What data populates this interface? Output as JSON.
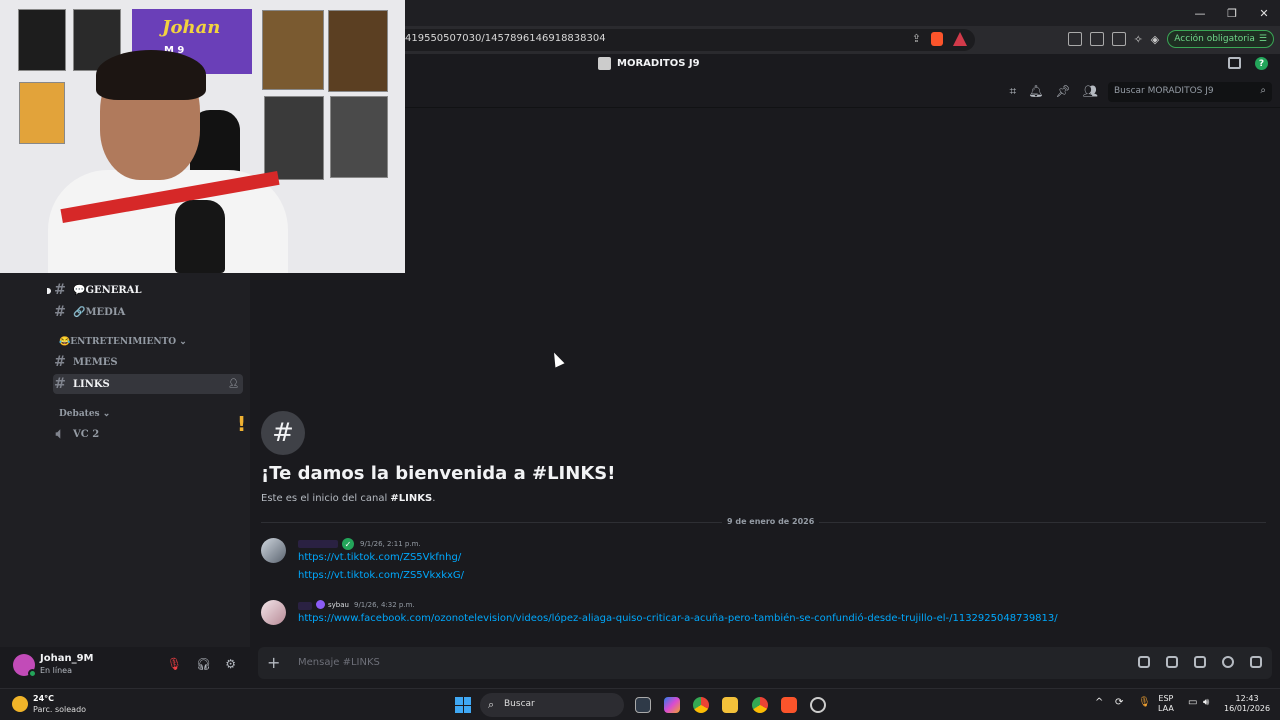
{
  "browser": {
    "url": "419550507030/1457896146918838304",
    "action_button": "Acción obligatoria",
    "window_controls": [
      "—",
      "❐",
      "✕"
    ]
  },
  "discord": {
    "server_name": "MORADITOS J9",
    "search_placeholder": "Buscar MORADITOS J9",
    "channels": {
      "general": "💬GENERAL",
      "media": "🔗MEDIA",
      "category_entertainment": "😂ENTRETENIMIENTO ⌄",
      "memes": "MEMES",
      "links": "LINKS",
      "category_debates": "Debates ⌄",
      "vc2": "VC 2"
    },
    "alert_mark": "!",
    "user": {
      "name": "Johan_9M",
      "status": "En línea"
    },
    "welcome": {
      "title": "¡Te damos la bienvenida a #LINKS!",
      "sub_prefix": "Este es el inicio del canal ",
      "sub_channel": "#LINKS",
      "sub_suffix": "."
    },
    "date_divider": "9 de enero de 2026",
    "messages": [
      {
        "time": "9/1/26, 2:11 p.m.",
        "links": [
          "https://vt.tiktok.com/ZS5Vkfnhg/",
          "https://vt.tiktok.com/ZS5VkxkxG/"
        ]
      },
      {
        "role": "sybau",
        "time": "9/1/26, 4:32 p.m.",
        "links": [
          "https://www.facebook.com/ozonotelevision/videos/lópez-aliaga-quiso-criticar-a-acuña-pero-también-se-confundió-desde-trujillo-el-/1132925048739813/"
        ]
      }
    ],
    "composer_placeholder": "Mensaje #LINKS"
  },
  "webcam": {
    "poster_name": "Johan",
    "poster_sub": "M 9"
  },
  "taskbar": {
    "weather_temp": "24°C",
    "weather_desc": "Parc. soleado",
    "search_label": "Buscar",
    "lang_top": "ESP",
    "lang_bottom": "LAA",
    "time": "12:43",
    "date": "16/01/2026"
  },
  "colors": {
    "link": "#00a8fc",
    "online": "#23a55a",
    "mute": "#f23f43",
    "alert": "#f0b232"
  }
}
